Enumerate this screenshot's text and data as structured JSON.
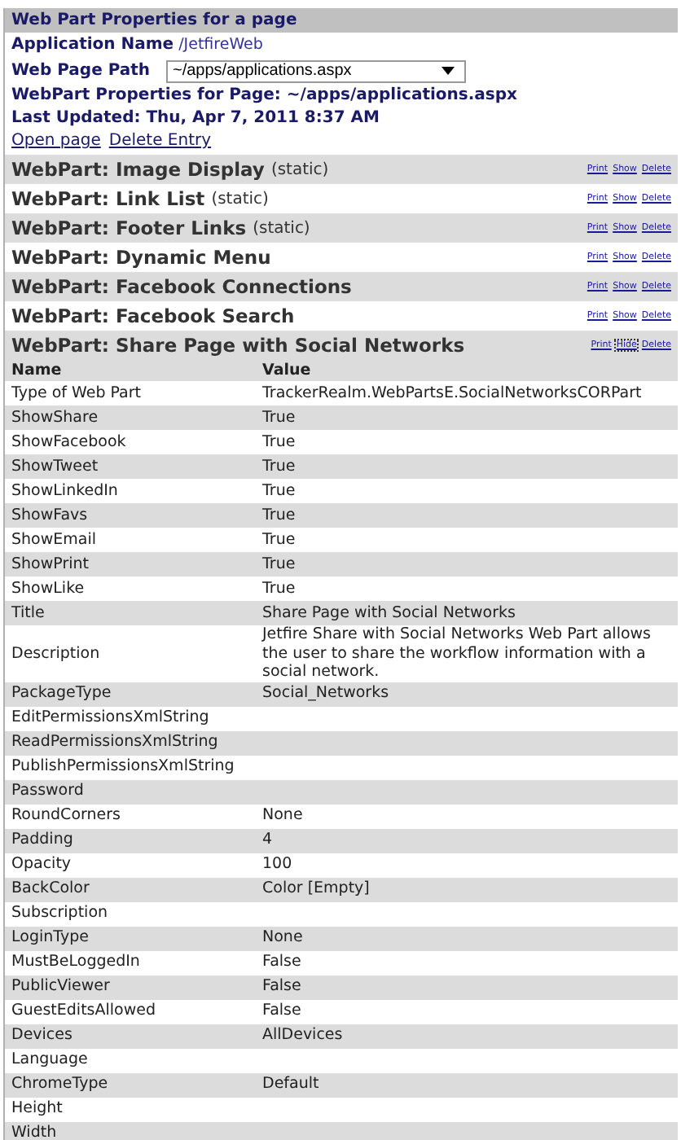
{
  "title": "Web Part Properties for a page",
  "info": {
    "app_label": "Application Name",
    "app_value": "/JetfireWeb",
    "path_label": "Web Page Path",
    "path_value": "~/apps/applications.aspx",
    "page_line": "WebPart Properties for Page: ~/apps/applications.aspx",
    "updated_line": "Last Updated: Thu, Apr 7, 2011 8:37 AM"
  },
  "actions": [
    "Open page",
    "Delete Entry"
  ],
  "webparts": [
    {
      "title": "WebPart: Image Display",
      "note": "(static)",
      "links": [
        {
          "label": "Print",
          "focused": false
        },
        {
          "label": "Show",
          "focused": false
        },
        {
          "label": "Delete",
          "focused": false
        }
      ]
    },
    {
      "title": "WebPart: Link List",
      "note": "(static)",
      "links": [
        {
          "label": "Print",
          "focused": false
        },
        {
          "label": "Show",
          "focused": false
        },
        {
          "label": "Delete",
          "focused": false
        }
      ]
    },
    {
      "title": "WebPart: Footer Links",
      "note": "(static)",
      "links": [
        {
          "label": "Print",
          "focused": false
        },
        {
          "label": "Show",
          "focused": false
        },
        {
          "label": "Delete",
          "focused": false
        }
      ]
    },
    {
      "title": "WebPart: Dynamic Menu",
      "links": [
        {
          "label": "Print",
          "focused": false
        },
        {
          "label": "Show",
          "focused": false
        },
        {
          "label": "Delete",
          "focused": false
        }
      ]
    },
    {
      "title": "WebPart: Facebook Connections",
      "links": [
        {
          "label": "Print",
          "focused": false
        },
        {
          "label": "Show",
          "focused": false
        },
        {
          "label": "Delete",
          "focused": false
        }
      ]
    },
    {
      "title": "WebPart: Facebook Search",
      "links": [
        {
          "label": "Print",
          "focused": false
        },
        {
          "label": "Show",
          "focused": false
        },
        {
          "label": "Delete",
          "focused": false
        }
      ]
    },
    {
      "title": "WebPart: Share Page with Social Networks",
      "links": [
        {
          "label": "Print",
          "focused": false
        },
        {
          "label": "Hide",
          "focused": true
        },
        {
          "label": "Delete",
          "focused": false
        }
      ]
    }
  ],
  "table": {
    "columns": [
      "Name",
      "Value"
    ],
    "rows": [
      {
        "name": "Type of Web Part",
        "value": "TrackerRealm.WebPartsE.SocialNetworksCORPart"
      },
      {
        "name": "ShowShare",
        "value": "True"
      },
      {
        "name": "ShowFacebook",
        "value": "True"
      },
      {
        "name": "ShowTweet",
        "value": "True"
      },
      {
        "name": "ShowLinkedIn",
        "value": "True"
      },
      {
        "name": "ShowFavs",
        "value": "True"
      },
      {
        "name": "ShowEmail",
        "value": "True"
      },
      {
        "name": "ShowPrint",
        "value": "True"
      },
      {
        "name": "ShowLike",
        "value": "True"
      },
      {
        "name": "Title",
        "value": "Share Page with Social Networks"
      },
      {
        "name": "Description",
        "value": "Jetfire Share with Social Networks Web Part allows the user to share the workflow information with a social network."
      },
      {
        "name": "PackageType",
        "value": "Social_Networks"
      },
      {
        "name": "EditPermissionsXmlString"
      },
      {
        "name": "ReadPermissionsXmlString"
      },
      {
        "name": "PublishPermissionsXmlString"
      },
      {
        "name": "Password"
      },
      {
        "name": "RoundCorners",
        "value": "None"
      },
      {
        "name": "Padding",
        "value": "4"
      },
      {
        "name": "Opacity",
        "value": "100"
      },
      {
        "name": "BackColor",
        "value": "Color [Empty]"
      },
      {
        "name": "Subscription"
      },
      {
        "name": "LoginType",
        "value": "None"
      },
      {
        "name": "MustBeLoggedIn",
        "value": "False"
      },
      {
        "name": "PublicViewer",
        "value": "False"
      },
      {
        "name": "GuestEditsAllowed",
        "value": "False"
      },
      {
        "name": "Devices",
        "value": "AllDevices"
      },
      {
        "name": "Language"
      },
      {
        "name": "ChromeType",
        "value": "Default"
      },
      {
        "name": "Height"
      },
      {
        "name": "Width"
      }
    ]
  }
}
